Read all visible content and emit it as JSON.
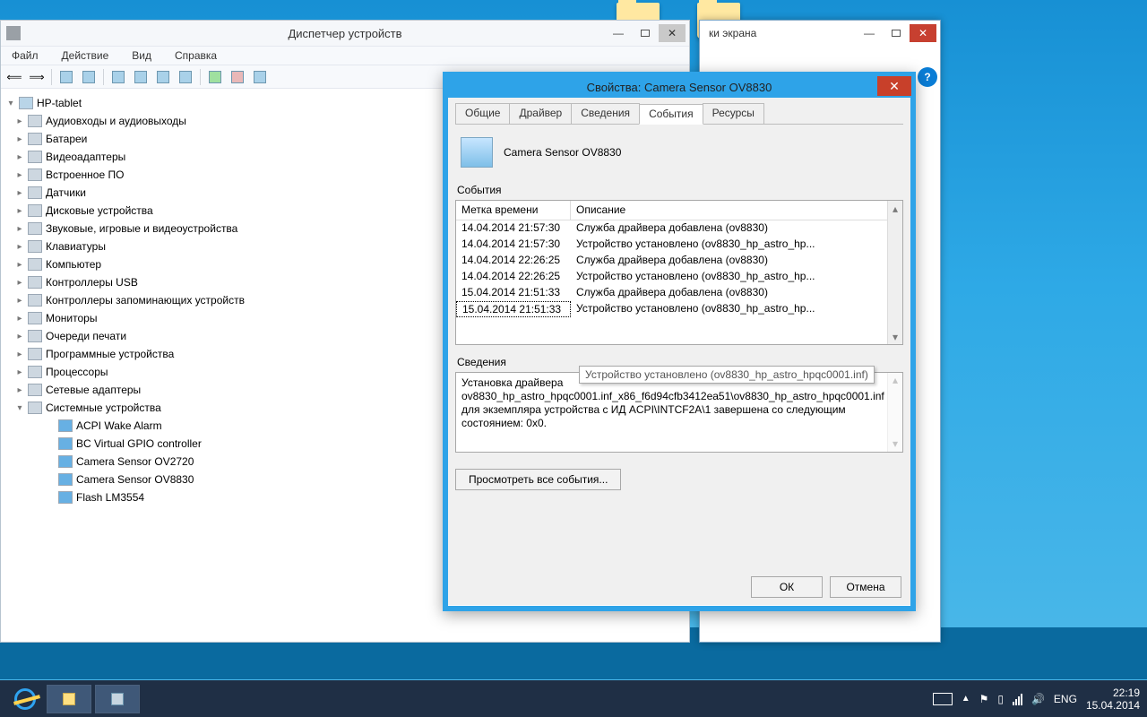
{
  "desktop": {
    "snip_title_partial": "ки экрана"
  },
  "device_manager": {
    "title": "Диспетчер устройств",
    "menu": [
      "Файл",
      "Действие",
      "Вид",
      "Справка"
    ],
    "root": "HP-tablet",
    "categories": [
      "Аудиовходы и аудиовыходы",
      "Батареи",
      "Видеоадаптеры",
      "Встроенное ПО",
      "Датчики",
      "Дисковые устройства",
      "Звуковые, игровые и видеоустройства",
      "Клавиатуры",
      "Компьютер",
      "Контроллеры USB",
      "Контроллеры запоминающих устройств",
      "Мониторы",
      "Очереди печати",
      "Программные устройства",
      "Процессоры",
      "Сетевые адаптеры"
    ],
    "expanded_category": "Системные устройства",
    "expanded_children": [
      "ACPI Wake Alarm",
      "BC Virtual GPIO controller",
      "Camera Sensor OV2720",
      "Camera Sensor OV8830",
      "Flash LM3554"
    ]
  },
  "properties": {
    "title": "Свойства: Camera Sensor OV8830",
    "tabs": [
      "Общие",
      "Драйвер",
      "Сведения",
      "События",
      "Ресурсы"
    ],
    "active_tab": "События",
    "device_name": "Camera Sensor OV8830",
    "events_label": "События",
    "columns": {
      "timestamp": "Метка времени",
      "description": "Описание"
    },
    "events": [
      {
        "ts": "14.04.2014 21:57:30",
        "desc": "Служба драйвера добавлена (ov8830)"
      },
      {
        "ts": "14.04.2014 21:57:30",
        "desc": "Устройство установлено (ov8830_hp_astro_hp..."
      },
      {
        "ts": "14.04.2014 22:26:25",
        "desc": "Служба драйвера добавлена (ov8830)"
      },
      {
        "ts": "14.04.2014 22:26:25",
        "desc": "Устройство установлено (ov8830_hp_astro_hp..."
      },
      {
        "ts": "15.04.2014 21:51:33",
        "desc": "Служба драйвера добавлена (ov8830)"
      },
      {
        "ts": "15.04.2014 21:51:33",
        "desc": "Устройство установлено (ov8830_hp_astro_hp...",
        "selected": true
      }
    ],
    "tooltip": "Устройство установлено (ov8830_hp_astro_hpqc0001.inf)",
    "details_label": "Сведения",
    "details_text": "Установка драйвера ov8830_hp_astro_hpqc0001.inf_x86_f6d94cfb3412ea51\\ov8830_hp_astro_hpqc0001.inf для экземпляра устройства с ИД ACPI\\INTCF2A\\1 завершена со следующим состоянием: 0x0.",
    "view_all_btn": "Просмотреть все события...",
    "ok_btn": "ОК",
    "cancel_btn": "Отмена"
  },
  "taskbar": {
    "lang": "ENG",
    "time": "22:19",
    "date": "15.04.2014"
  }
}
